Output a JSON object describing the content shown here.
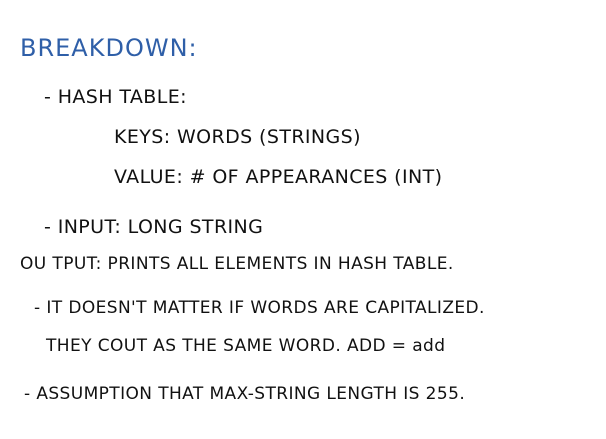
{
  "colors": {
    "ink": "#111111",
    "title_ink": "#2f5fa8",
    "paper": "#ffffff"
  },
  "notes": {
    "title": "BREAKDOWN:",
    "lines": [
      "- HASH TABLE:",
      "KEYS: WORDS (STRINGS)",
      "VALUE: # OF APPEARANCES (INT)",
      "- INPUT: LONG STRING",
      "OU TPUT: PRINTS ALL ELEMENTS IN HASH TABLE.",
      "- IT DOESN'T MATTER IF WORDS ARE CAPITALIZED.",
      "THEY COUT AS THE SAME WORD. ADD = add",
      "- ASSUMPTION THAT MAX-STRING LENGTH IS 255."
    ]
  }
}
